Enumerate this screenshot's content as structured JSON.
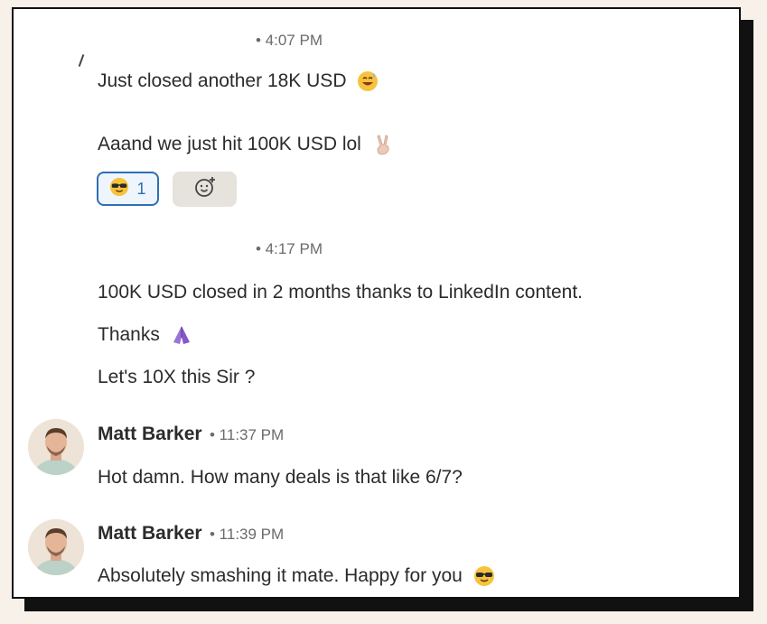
{
  "messages_block_1": {
    "timestamp": "• 4:07 PM",
    "line1": "Just closed another 18K USD",
    "line2": "Aaand we just hit 100K USD lol",
    "reaction_count": "1"
  },
  "messages_block_2": {
    "timestamp": "• 4:17 PM",
    "line1": "100K USD closed in 2 months thanks to LinkedIn content.",
    "line2": "Thanks",
    "line3": "Let's 10X this Sir ?"
  },
  "reply_1": {
    "author": "Matt Barker",
    "timestamp": "• 11:37 PM",
    "text": "Hot damn. How many deals is that like 6/7?"
  },
  "reply_2": {
    "author": "Matt Barker",
    "timestamp": "• 11:39 PM",
    "text": "Absolutely smashing it mate. Happy for you"
  },
  "icons": {
    "sweat_smile": "sweat-smile-emoji",
    "victory_hand": "victory-hand-emoji",
    "sunglasses": "sunglasses-emoji",
    "praying_hands": "praying-hands-emoji",
    "add_reaction": "add-reaction-icon"
  },
  "colors": {
    "background": "#f7f1e9",
    "frame_border": "#111111",
    "reaction_accent": "#2f6fb3"
  }
}
